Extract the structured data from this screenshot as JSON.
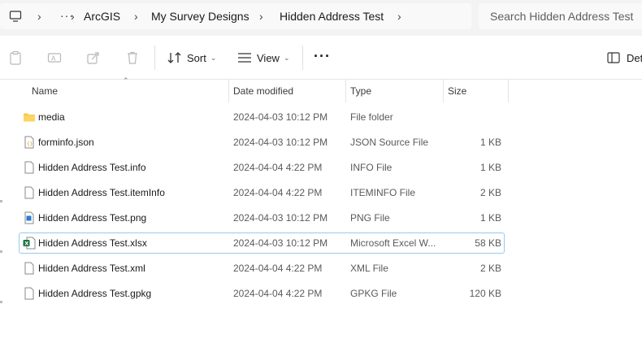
{
  "breadcrumb": {
    "items": [
      "ArcGIS",
      "My Survey Designs",
      "Hidden Address Test"
    ],
    "overflow": "···"
  },
  "search": {
    "placeholder": "Search Hidden Address Test"
  },
  "toolbar": {
    "sort_label": "Sort",
    "view_label": "View",
    "more_label": "···",
    "details_label": "Det"
  },
  "columns": {
    "name": "Name",
    "date": "Date modified",
    "type": "Type",
    "size": "Size"
  },
  "files": [
    {
      "name": "media",
      "date": "2024-04-03 10:12 PM",
      "type": "File folder",
      "size": "",
      "icon": "folder-icon"
    },
    {
      "name": "forminfo.json",
      "date": "2024-04-03 10:12 PM",
      "type": "JSON Source File",
      "size": "1 KB",
      "icon": "json-file-icon"
    },
    {
      "name": "Hidden Address Test.info",
      "date": "2024-04-04 4:22 PM",
      "type": "INFO File",
      "size": "1 KB",
      "icon": "file-icon"
    },
    {
      "name": "Hidden Address Test.itemInfo",
      "date": "2024-04-04 4:22 PM",
      "type": "ITEMINFO File",
      "size": "2 KB",
      "icon": "file-icon"
    },
    {
      "name": "Hidden Address Test.png",
      "date": "2024-04-03 10:12 PM",
      "type": "PNG File",
      "size": "1 KB",
      "icon": "image-file-icon"
    },
    {
      "name": "Hidden Address Test.xlsx",
      "date": "2024-04-03 10:12 PM",
      "type": "Microsoft Excel W...",
      "size": "58 KB",
      "icon": "excel-file-icon",
      "selected": true
    },
    {
      "name": "Hidden Address Test.xml",
      "date": "2024-04-04 4:22 PM",
      "type": "XML File",
      "size": "2 KB",
      "icon": "file-icon"
    },
    {
      "name": "Hidden Address Test.gpkg",
      "date": "2024-04-04 4:22 PM",
      "type": "GPKG File",
      "size": "120 KB",
      "icon": "file-icon"
    }
  ],
  "colors": {
    "selection_border": "#99c9ef",
    "folder": "#f8c84a",
    "excel": "#1d7044"
  }
}
